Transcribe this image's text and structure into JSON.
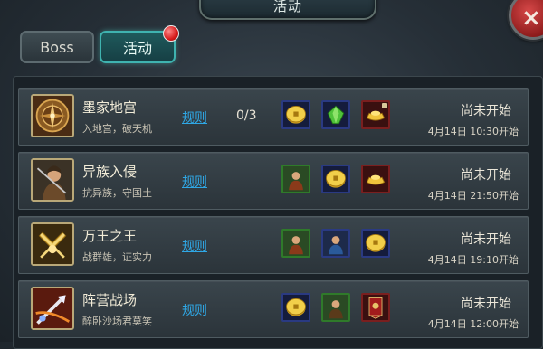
{
  "header": {
    "title": "活动"
  },
  "close": {
    "label": "×"
  },
  "tabs": [
    {
      "label": "Boss"
    },
    {
      "label": "活动"
    }
  ],
  "activities": [
    {
      "name": "墨家地宫",
      "desc": "入地宫，破天机",
      "rules": "规则",
      "count": "0/3",
      "rewards": [
        "gold-coin-icon",
        "green-gem-icon",
        "gold-ingot-icon"
      ],
      "status": "尚未开始",
      "time": "4月14日 10:30开始"
    },
    {
      "name": "异族入侵",
      "desc": "抗异族，守国土",
      "rules": "规则",
      "count": "",
      "rewards": [
        "general-portrait-icon",
        "gold-coin-icon",
        "gold-ingot-icon"
      ],
      "status": "尚未开始",
      "time": "4月14日 21:50开始"
    },
    {
      "name": "万王之王",
      "desc": "战群雄，证实力",
      "rules": "规则",
      "count": "",
      "rewards": [
        "general-portrait-icon",
        "general-portrait-icon",
        "gold-coin-icon"
      ],
      "status": "尚未开始",
      "time": "4月14日 19:10开始"
    },
    {
      "name": "阵营战场",
      "desc": "醉卧沙场君莫笑",
      "rules": "规则",
      "count": "",
      "rewards": [
        "gold-coin-icon",
        "general-portrait-icon",
        "war-banner-icon"
      ],
      "status": "尚未开始",
      "time": "4月14日 12:00开始"
    }
  ]
}
